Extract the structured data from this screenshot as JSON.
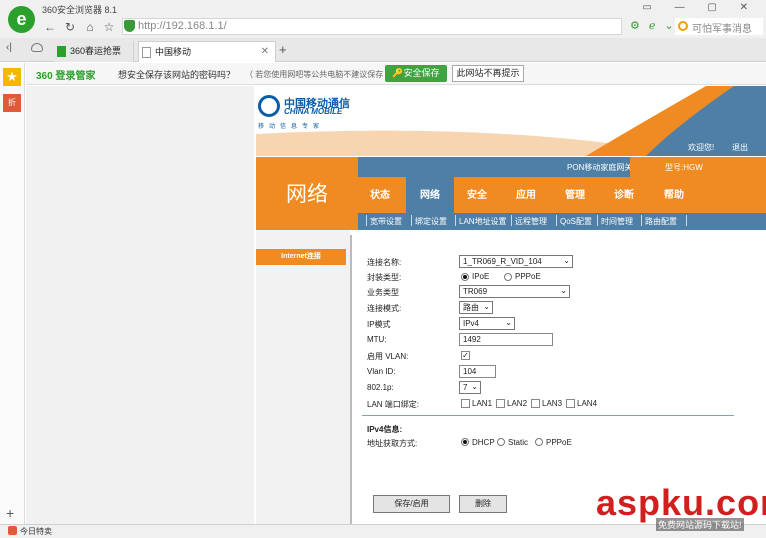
{
  "browser": {
    "window_title": "360安全浏览器 8.1",
    "address_url": "http://192.168.1.1/",
    "search_placeholder": "可怕军事消息",
    "tabs": [
      {
        "label": "360春运抢票"
      },
      {
        "label": "中国移动"
      }
    ],
    "status_text": "今日特卖"
  },
  "password_bar": {
    "brand": "360 登录管家",
    "question": "想安全保存该网站的密码吗？",
    "hint": "（ 若您使用网吧等公共电脑不建议保存 ）",
    "save_button": "安全保存",
    "never_button": "此网站不再提示"
  },
  "router": {
    "logo_cn": "中国移动通信",
    "logo_en": "CHINA MOBILE",
    "slogan": "移动信息专家",
    "welcome": "欢迎您!",
    "logout": "退出",
    "device_name": "PON移动家庭网关",
    "model": "型号:HGW",
    "section_title": "网络",
    "menu": [
      "状态",
      "网络",
      "安全",
      "应用",
      "管理",
      "诊断",
      "帮助"
    ],
    "active_menu": "网络",
    "submenu": [
      "宽带设置",
      "绑定设置",
      "LAN地址设置",
      "远程管理",
      "QoS配置",
      "时间管理",
      "路由配置"
    ],
    "left_tab": "Internet连接"
  },
  "form": {
    "conn_name_label": "连接名称:",
    "conn_name_value": "1_TR069_R_VID_104",
    "encap_label": "封装类型:",
    "encap_options": [
      "IPoE",
      "PPPoE"
    ],
    "encap_selected": "IPoE",
    "service_label": "业务类型",
    "service_value": "TR069",
    "conn_mode_label": "连接模式:",
    "conn_mode_value": "路由",
    "ip_mode_label": "IP模式",
    "ip_mode_value": "IPv4",
    "mtu_label": "MTU:",
    "mtu_value": "1492",
    "vlan_enable_label": "启用 VLAN:",
    "vlan_enable_checked": true,
    "vlan_id_label": "Vlan ID:",
    "vlan_id_value": "104",
    "p8021_label": "802.1p:",
    "p8021_value": "7",
    "lan_bind_label": "LAN 端口绑定:",
    "lan_ports": [
      "LAN1",
      "LAN2",
      "LAN3",
      "LAN4"
    ],
    "ipv4_section": "IPv4信息:",
    "addr_mode_label": "地址获取方式:",
    "addr_options": [
      "DHCP",
      "Static",
      "PPPoE"
    ],
    "addr_selected": "DHCP",
    "save_button": "保存/启用",
    "delete_button": "删除"
  },
  "watermark": {
    "main": "aspku.com",
    "sub": "免费网站源码下载站!"
  },
  "colors": {
    "router_orange": "#f08a22",
    "router_blue": "#4e7fa6",
    "brand_green": "#2ca02c",
    "watermark_red": "#d11f1f"
  }
}
